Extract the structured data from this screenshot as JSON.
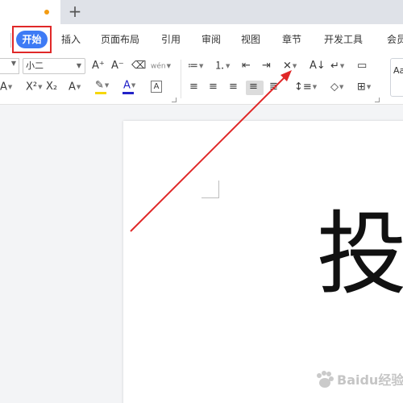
{
  "tabs": {
    "new_tab_glyph": "+"
  },
  "menu": {
    "items": [
      "开始",
      "插入",
      "页面布局",
      "引用",
      "审阅",
      "视图",
      "章节",
      "开发工具",
      "会员"
    ]
  },
  "ribbon": {
    "font_size_value": "小二",
    "row1": {
      "grow_font": "A⁺",
      "shrink_font": "A⁻",
      "clear_format": "⌫",
      "phonetic": "wén",
      "bullets": "≔",
      "numbering": "⒈",
      "indent_decrease": "⇤",
      "indent_increase": "⇥",
      "chinese_layout": "✕",
      "show_marks": "A↓",
      "line_break": "↵",
      "table_ruler": "▭"
    },
    "row2": {
      "text_effect": "A",
      "superscript": "X²",
      "subscript": "X₂",
      "outline_text": "A",
      "highlight": "✎",
      "font_color": "A",
      "char_border": "A",
      "align_left": "≡",
      "align_center": "≡",
      "align_right": "≡",
      "justify": "≡",
      "distribute": "≣",
      "line_spacing": "↕≡",
      "shading": "◇",
      "borders": "⊞"
    },
    "style_preview": "Aa",
    "colors": {
      "highlight": "#f6d70a",
      "font_color": "#2323c8",
      "accent": "#3e7bf5",
      "annotation": "#e02828"
    }
  },
  "document": {
    "content": "投"
  },
  "watermark": {
    "text": "Baidu经验"
  }
}
